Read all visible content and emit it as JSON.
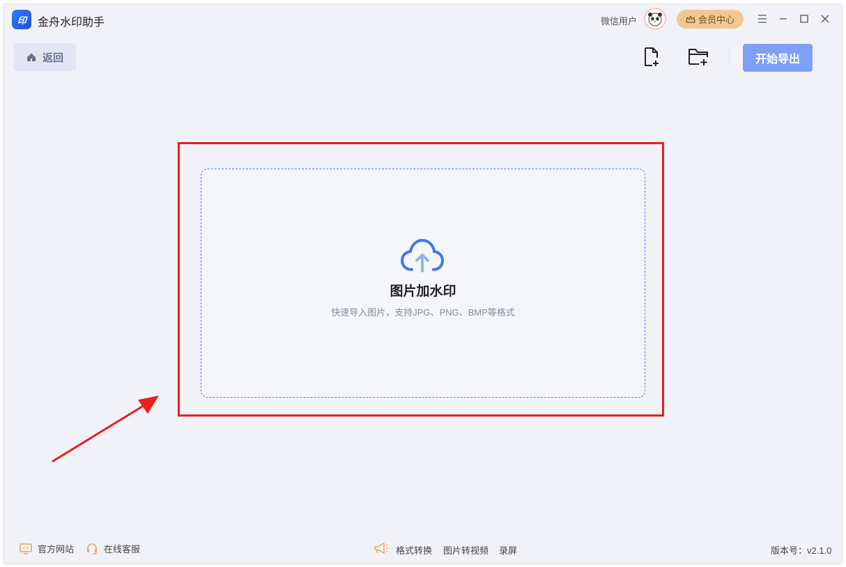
{
  "app": {
    "title": "金舟水印助手",
    "logo_text": "印"
  },
  "header": {
    "user_name": "微信用户",
    "vip_label": "会员中心"
  },
  "toolbar": {
    "back_label": "返回",
    "export_label": "开始导出"
  },
  "drop": {
    "title": "图片加水印",
    "subtitle": "快速导入图片，支持JPG、PNG、BMP等格式"
  },
  "footer": {
    "website": "官方网站",
    "service": "在线客服",
    "links": [
      "格式转换",
      "图片转视频",
      "录屏"
    ],
    "version": "版本号：v2.1.0"
  },
  "colors": {
    "accent": "#7fa0f5",
    "highlight": "#ee1c1c",
    "vip": "#f2c892"
  }
}
